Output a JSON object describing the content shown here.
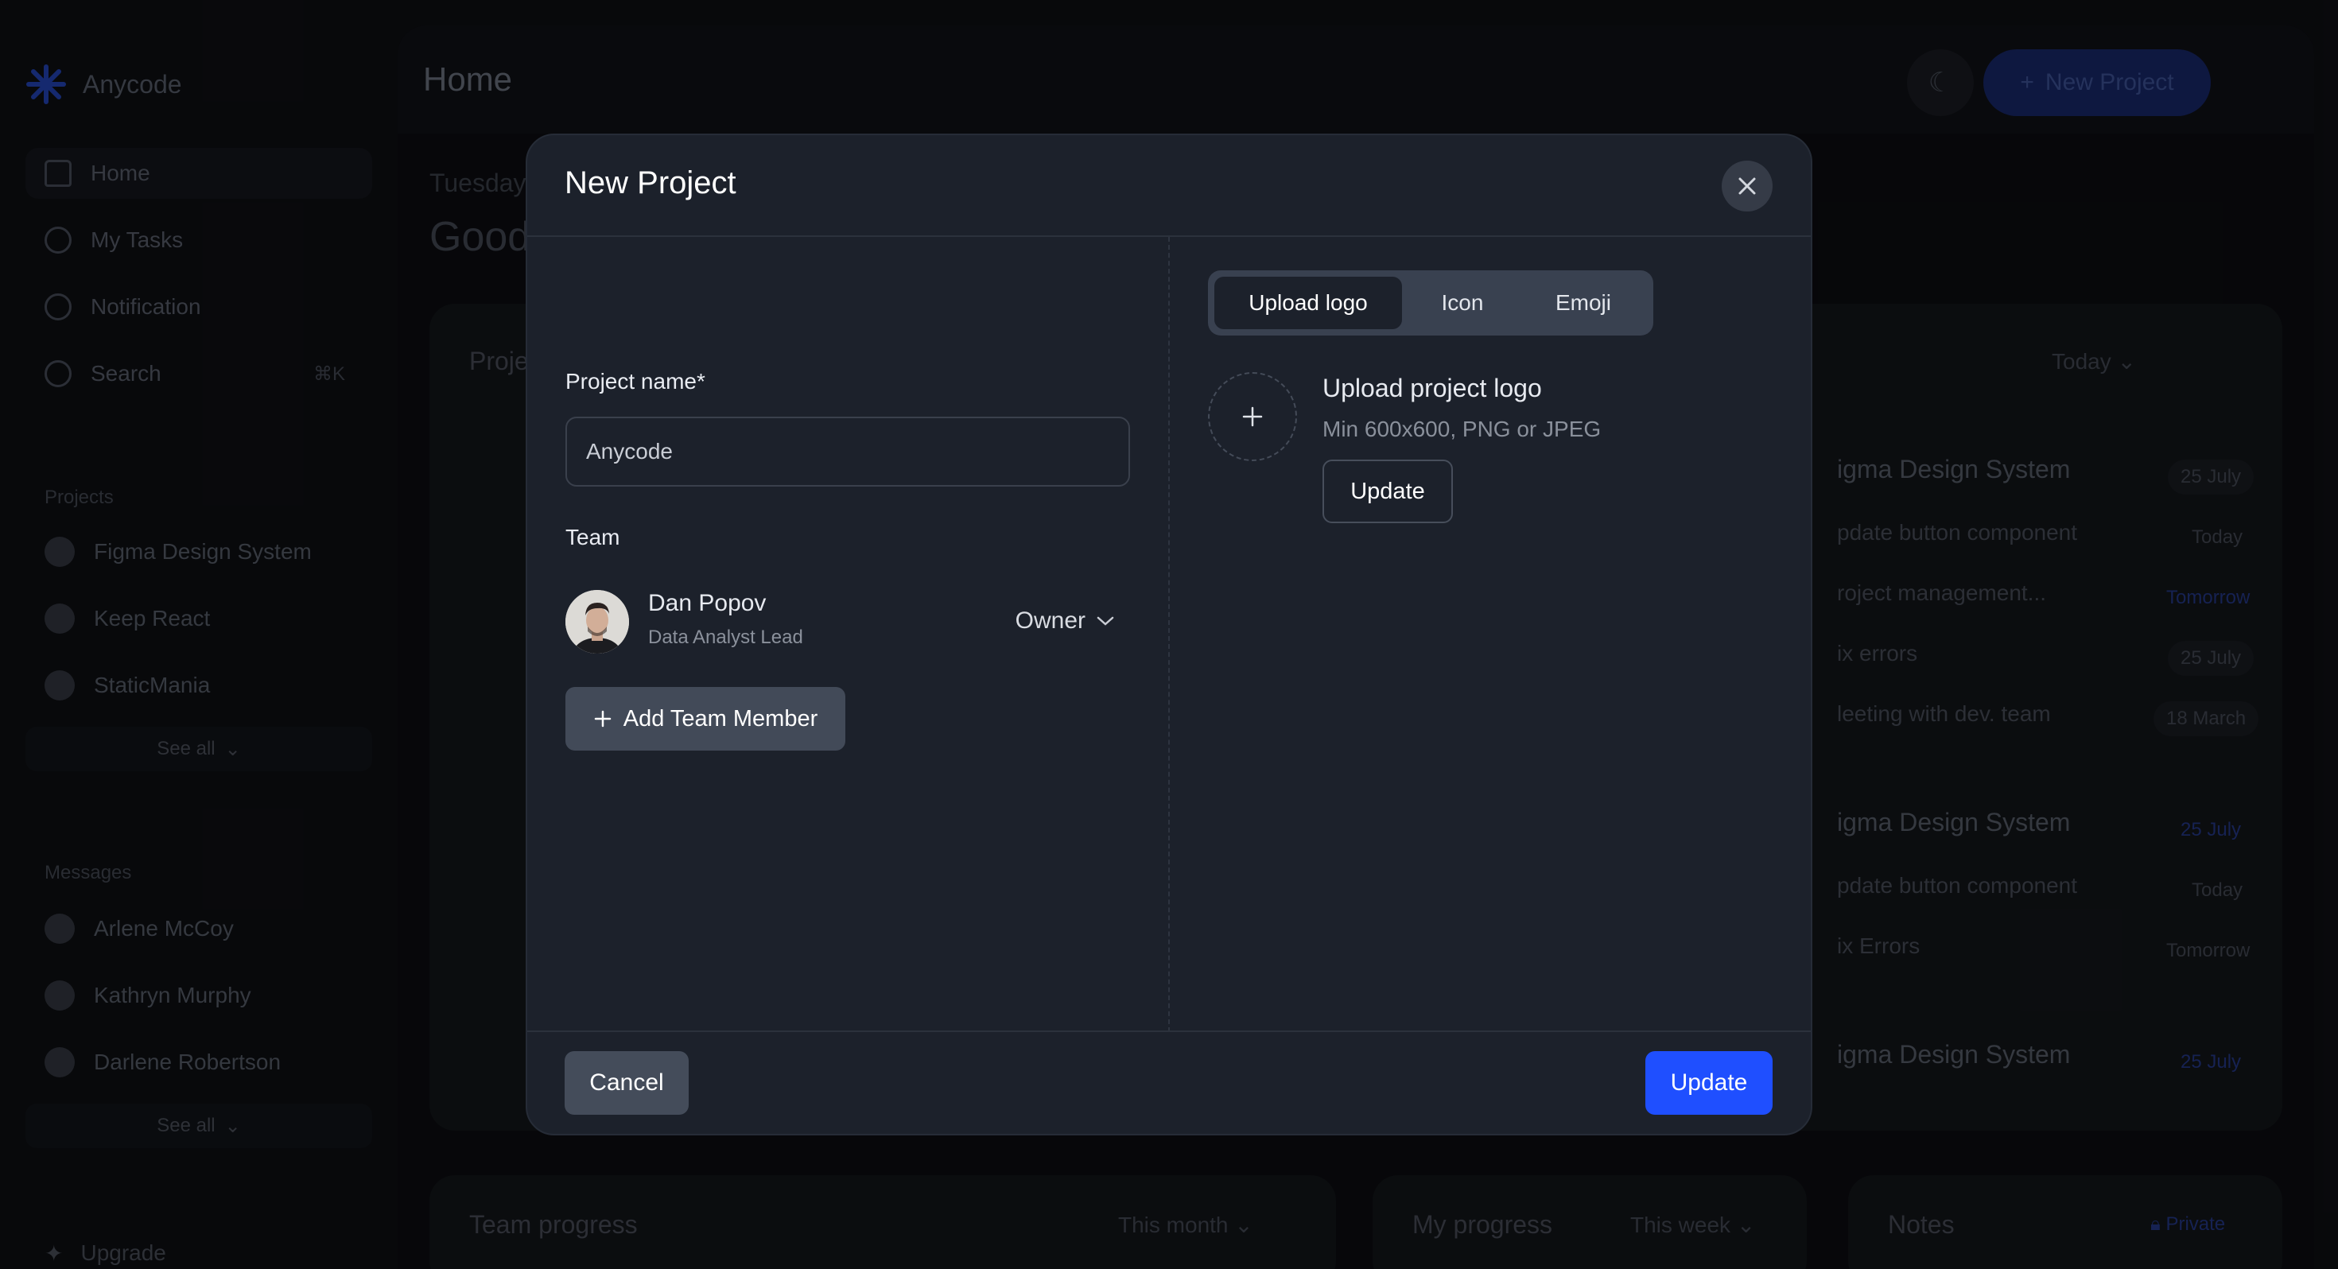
{
  "app": {
    "name": "Anycode"
  },
  "sidebar": {
    "nav": [
      {
        "label": "Home",
        "icon": "home-icon"
      },
      {
        "label": "My Tasks",
        "icon": "check-circle-icon"
      },
      {
        "label": "Notification",
        "icon": "bell-icon"
      },
      {
        "label": "Search",
        "icon": "search-icon",
        "shortcut": "⌘K"
      }
    ],
    "projects_title": "Projects",
    "projects": [
      "Figma Design System",
      "Keep React",
      "StaticMania"
    ],
    "see_all": "See all",
    "messages_title": "Messages",
    "messages": [
      "Arlene McCoy",
      "Kathryn Murphy",
      "Darlene Robertson"
    ],
    "upgrade": "Upgrade"
  },
  "header": {
    "title": "Home",
    "new_project": "New Project"
  },
  "dashboard": {
    "date": "Tuesday",
    "greeting": "Good",
    "projects_panel_title": "Proje",
    "tasks_filter": "Today",
    "tasks": [
      {
        "title": "igma Design System",
        "date": "25 July",
        "sub": [
          {
            "label": "pdate button component",
            "date": "Today"
          },
          {
            "label": "roject management...",
            "date": "Tomorrow"
          },
          {
            "label": "ix errors",
            "date": "25 July"
          },
          {
            "label": "leeting with dev. team",
            "date": "18 March"
          }
        ]
      },
      {
        "title": "igma Design System",
        "date": "25 July",
        "sub": [
          {
            "label": "pdate button component",
            "date": "Today"
          },
          {
            "label": "ix Errors",
            "date": "Tomorrow"
          }
        ]
      },
      {
        "title": "igma Design System",
        "date": "25 July",
        "sub": []
      }
    ],
    "team_progress": "Team progress",
    "team_filter": "This month",
    "my_progress": "My progress",
    "my_filter": "This week",
    "notes": "Notes",
    "notes_private": "Private"
  },
  "modal": {
    "title": "New Project",
    "project_name_label": "Project name*",
    "project_name_value": "Anycode",
    "team_label": "Team",
    "member": {
      "name": "Dan Popov",
      "role": "Data Analyst Lead",
      "permission": "Owner"
    },
    "add_member": "Add Team Member",
    "tabs": [
      "Upload logo",
      "Icon",
      "Emoji"
    ],
    "active_tab": "Upload logo",
    "upload_title": "Upload project logo",
    "upload_hint": "Min 600x600, PNG or JPEG",
    "upload_button": "Update",
    "cancel": "Cancel",
    "submit": "Update"
  },
  "colors": {
    "primary": "#1f4fff",
    "modal_bg": "#1c212b",
    "page_bg": "#0c0d10"
  }
}
